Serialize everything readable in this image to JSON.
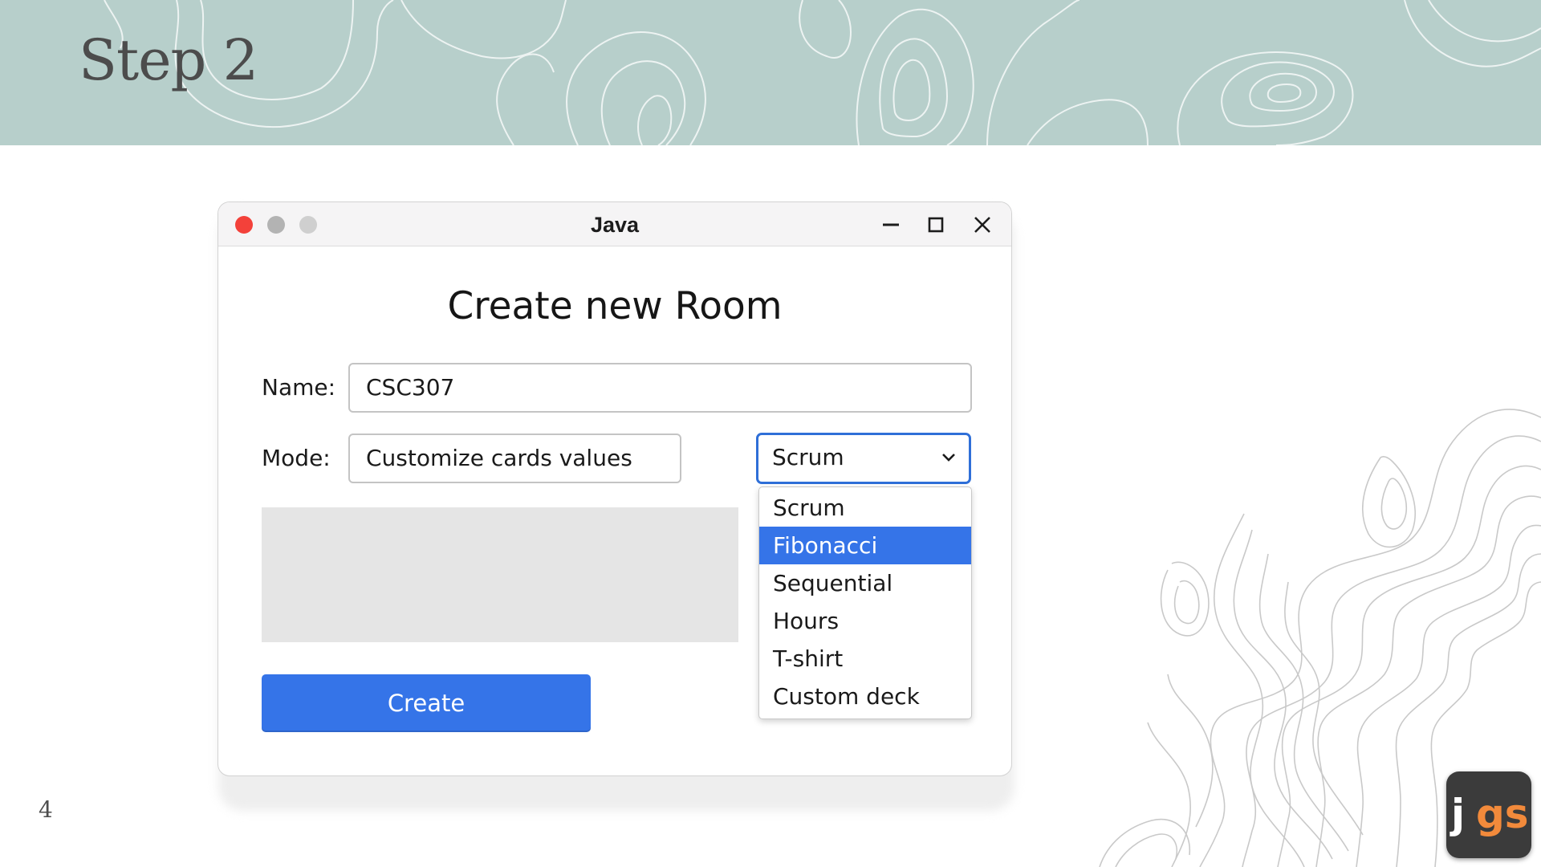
{
  "slide": {
    "title": "Step 2",
    "page_number": "4",
    "logo_j": "j",
    "logo_gs": "gs"
  },
  "window": {
    "title": "Java",
    "controls": [
      "close-dot",
      "minimize-dot",
      "zoom-dot",
      "minimize-icon",
      "maximize-icon",
      "close-icon"
    ]
  },
  "form": {
    "heading": "Create new Room",
    "name_label": "Name:",
    "name_value": "CSC307",
    "mode_label": "Mode:",
    "mode_value": "Customize cards values",
    "deck_selected": "Scrum",
    "create_label": "Create"
  },
  "dropdown": {
    "options": [
      "Scrum",
      "Fibonacci",
      "Sequential",
      "Hours",
      "T-shirt",
      "Custom deck"
    ],
    "highlighted": "Fibonacci"
  },
  "colors": {
    "header_bg": "#b7cfcb",
    "accent": "#3574e8",
    "close_dot": "#f3413a",
    "logo_orange": "#f28a3b"
  }
}
